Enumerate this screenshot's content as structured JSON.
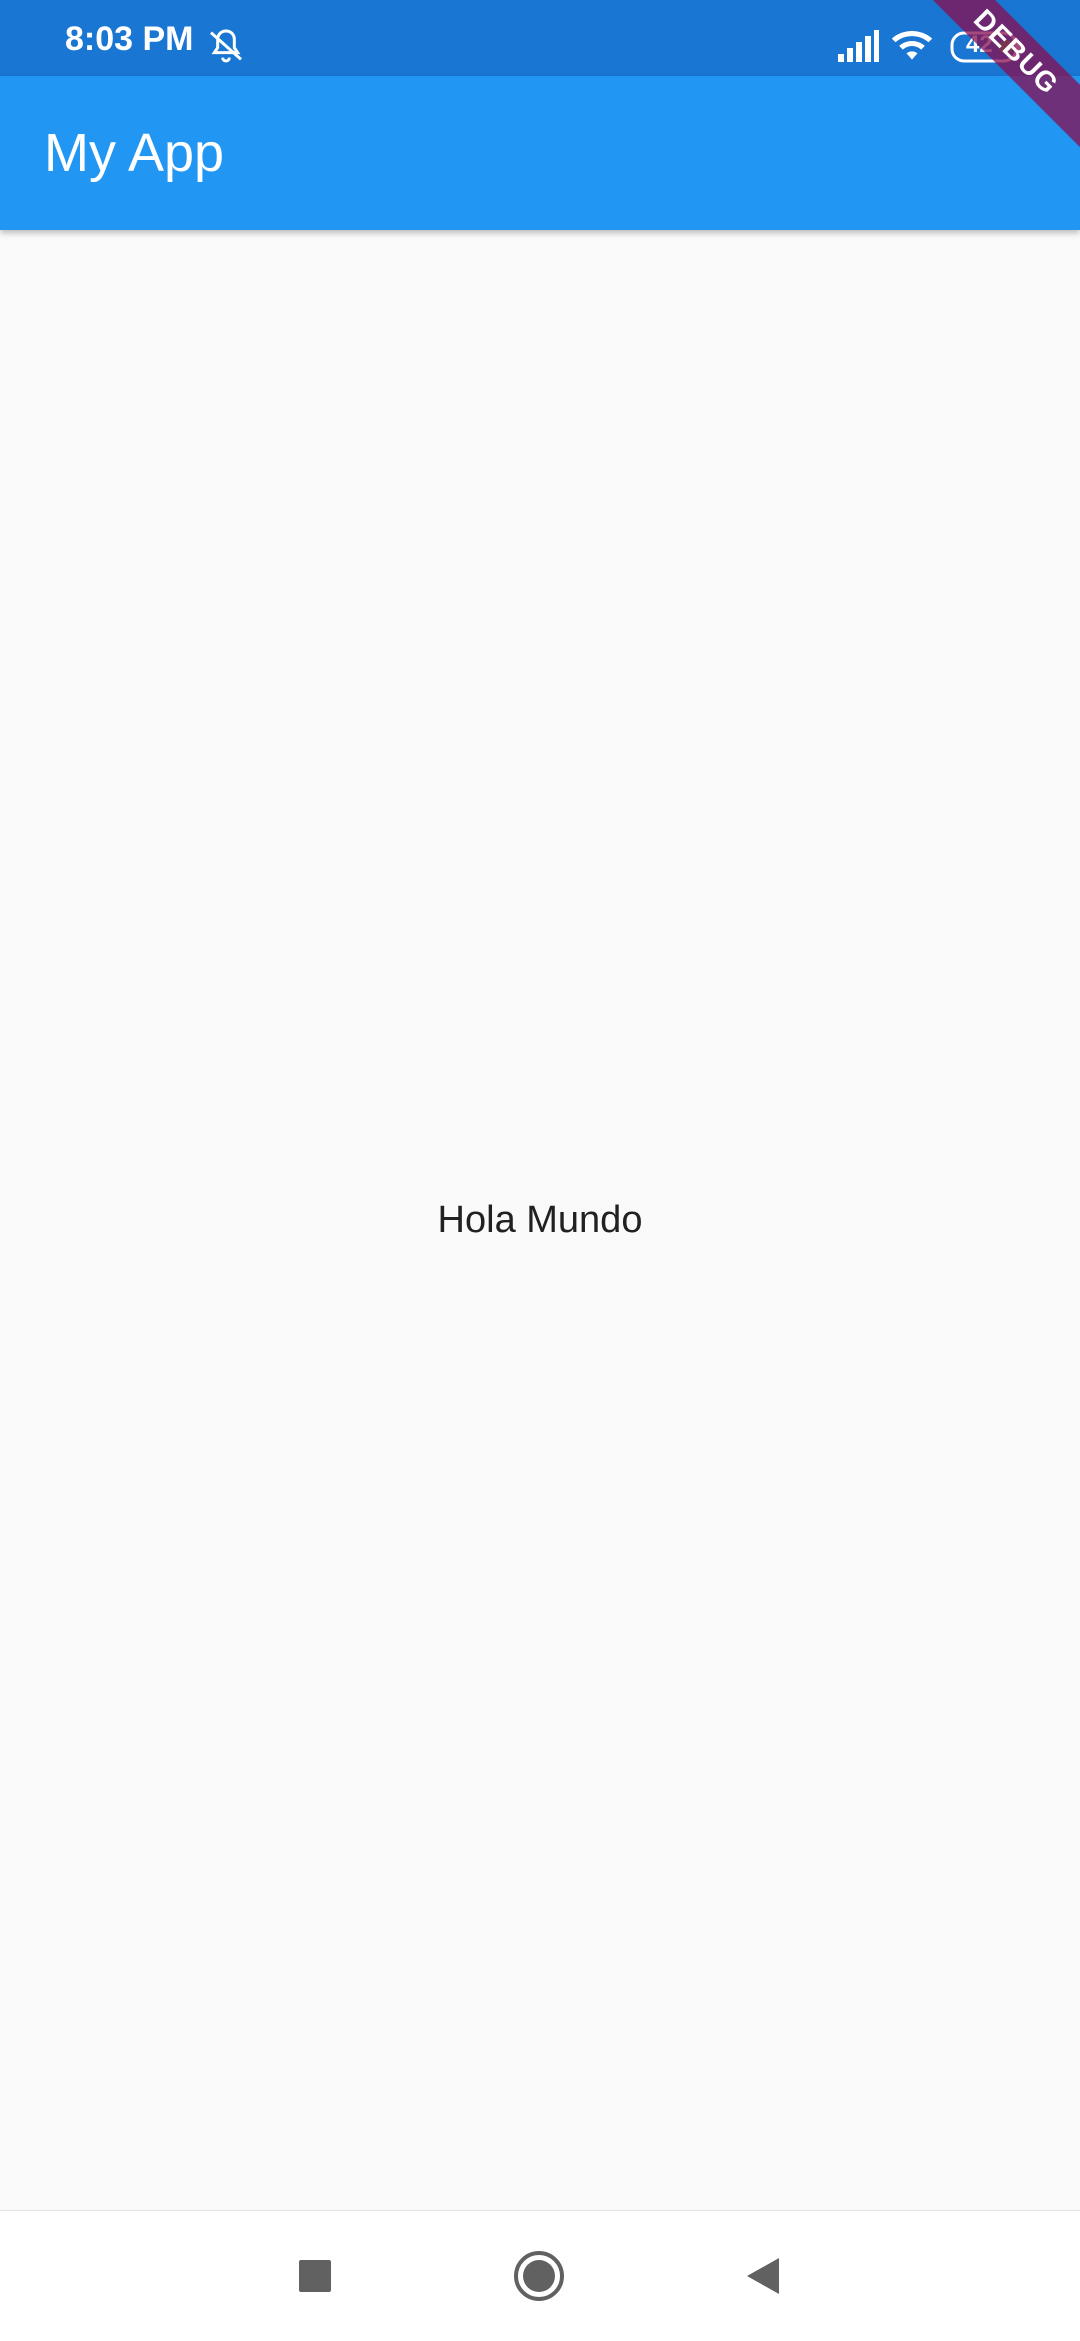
{
  "status_bar": {
    "time": "8:03 PM",
    "battery": "42",
    "icons": [
      "bell-off-icon",
      "signal-icon",
      "wifi-icon",
      "battery-icon"
    ]
  },
  "app_bar": {
    "title": "My App",
    "color": "#2196f3"
  },
  "debug_banner": {
    "label": "DEBUG"
  },
  "main": {
    "text": "Hola Mundo"
  },
  "nav_bar": {
    "icons": [
      "recents-icon",
      "home-icon",
      "back-icon"
    ]
  },
  "colors": {
    "status_bar": "#1976d2",
    "app_bar": "#2196f3",
    "background": "#fafafa",
    "debug": "#880e4f"
  }
}
